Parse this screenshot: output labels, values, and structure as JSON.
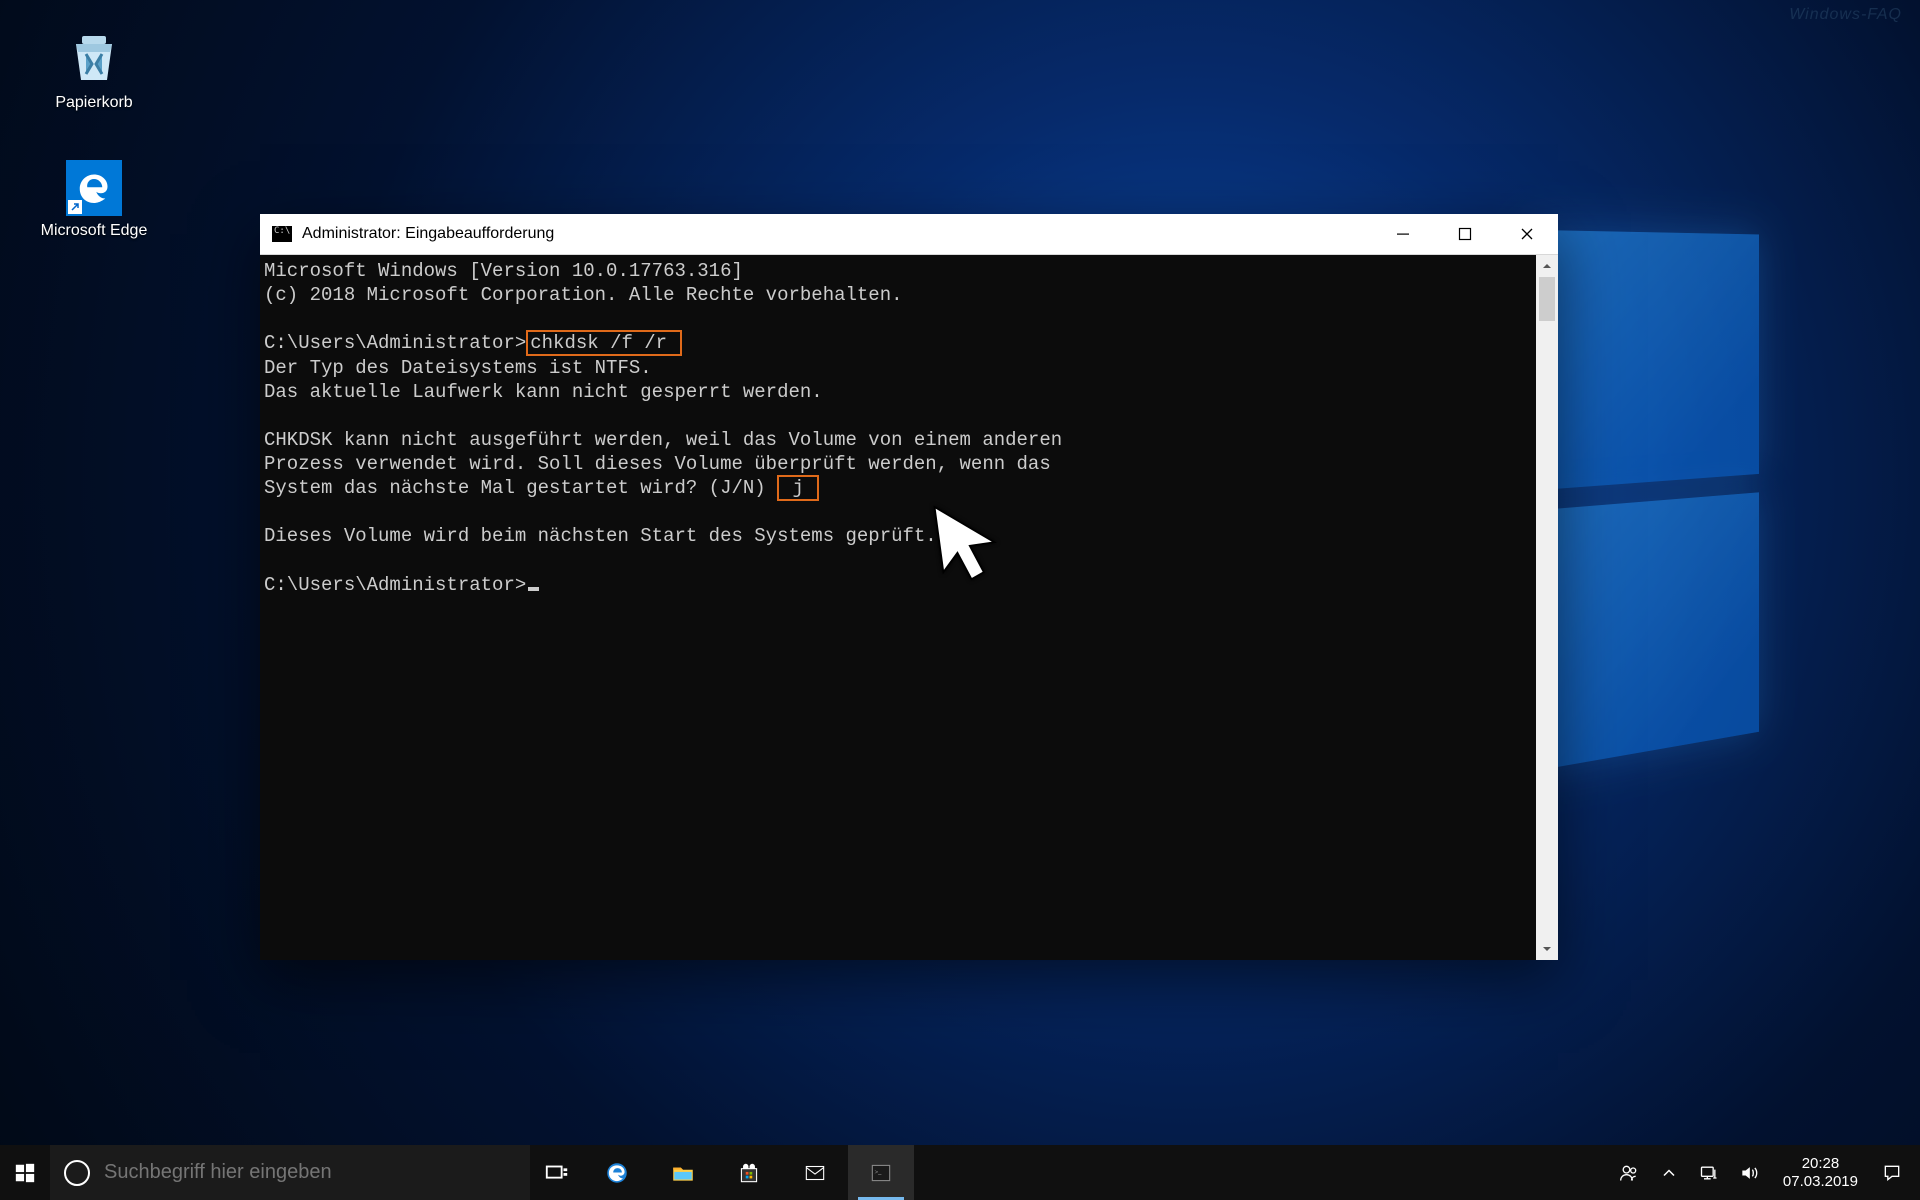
{
  "watermark": "Windows-FAQ",
  "desktop_icons": {
    "recycle_bin": "Papierkorb",
    "edge": "Microsoft Edge"
  },
  "window": {
    "title": "Administrator: Eingabeaufforderung",
    "terminal": {
      "line_version": "Microsoft Windows [Version 10.0.17763.316]",
      "line_copyright": "(c) 2018 Microsoft Corporation. Alle Rechte vorbehalten.",
      "prompt1_prefix": "C:\\Users\\Administrator>",
      "prompt1_cmd": "chkdsk /f /r",
      "line_fs": "Der Typ des Dateisystems ist NTFS.",
      "line_lock": "Das aktuelle Laufwerk kann nicht gesperrt werden.",
      "line_msg1": "CHKDSK kann nicht ausgeführt werden, weil das Volume von einem anderen",
      "line_msg2": "Prozess verwendet wird. Soll dieses Volume überprüft werden, wenn das",
      "line_msg3_pre": "System das nächste Mal gestartet wird? (J/N) ",
      "line_msg3_ans": "j",
      "line_confirm": "Dieses Volume wird beim nächsten Start des Systems geprüft.",
      "prompt2": "C:\\Users\\Administrator>"
    }
  },
  "taskbar": {
    "search_placeholder": "Suchbegriff hier eingeben",
    "clock_time": "20:28",
    "clock_date": "07.03.2019"
  }
}
